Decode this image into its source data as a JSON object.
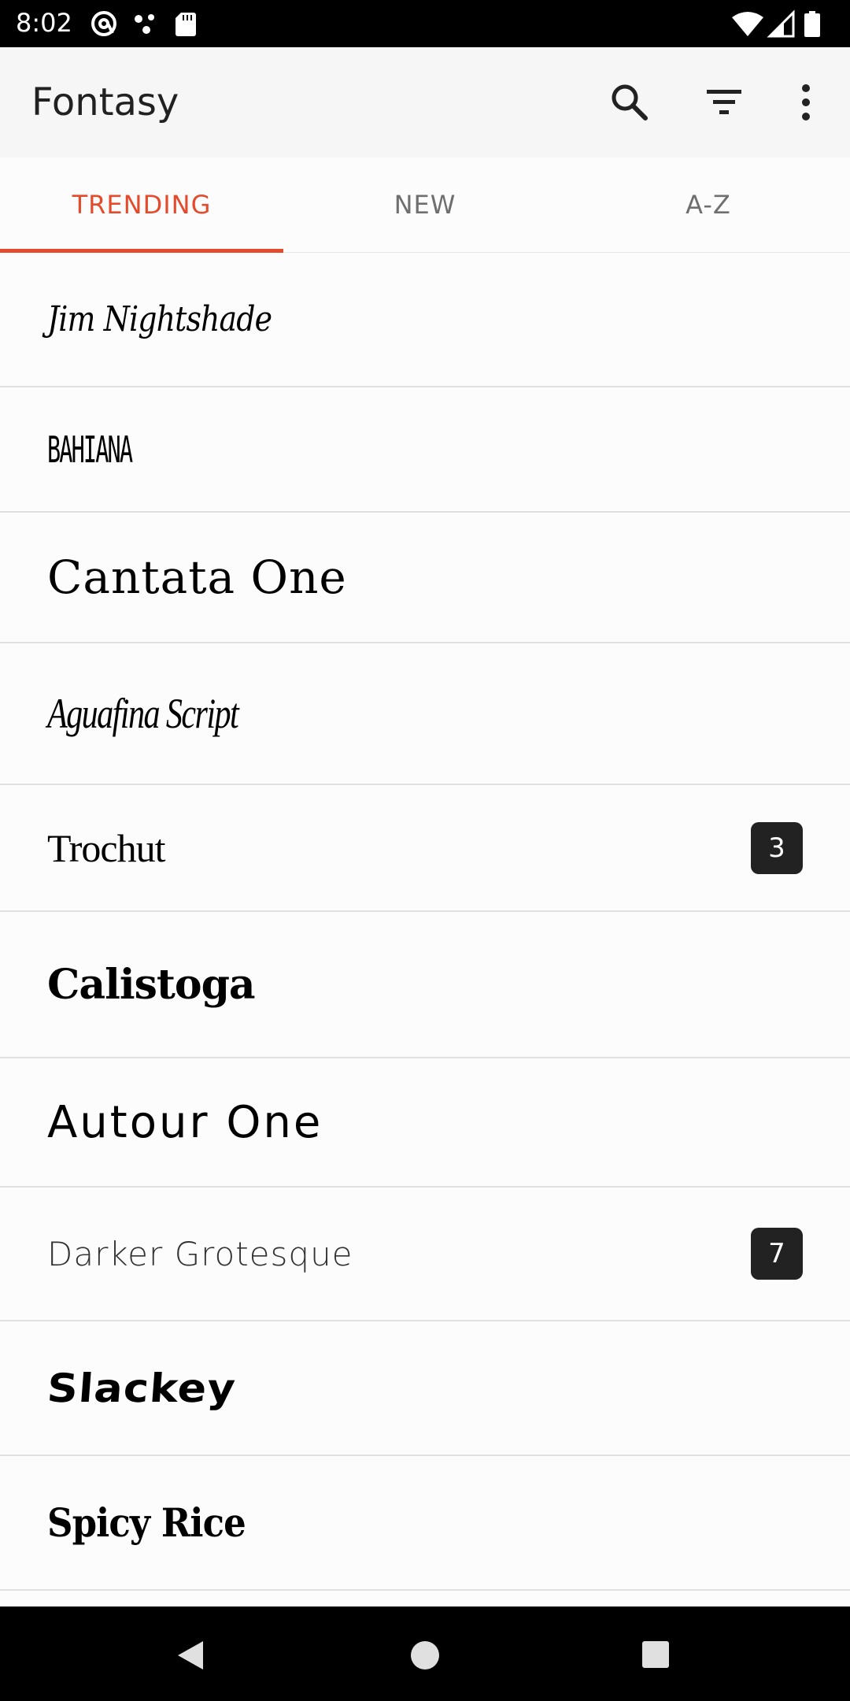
{
  "status_bar": {
    "time": "8:02",
    "left_icons": [
      "at-sign-icon",
      "nodes-icon",
      "sd-card-icon"
    ],
    "right_icons": [
      "wifi-icon",
      "signal-icon",
      "battery-icon"
    ]
  },
  "app_bar": {
    "title": "Fontasy",
    "actions": [
      "search-icon",
      "filter-icon",
      "more-vert-icon"
    ]
  },
  "tabs": [
    {
      "label": "TRENDING",
      "active": true
    },
    {
      "label": "NEW",
      "active": false
    },
    {
      "label": "A-Z",
      "active": false
    }
  ],
  "fonts": [
    {
      "name": "Jim Nightshade",
      "badge": null
    },
    {
      "name": "BAHIANA",
      "badge": null
    },
    {
      "name": "Cantata One",
      "badge": null
    },
    {
      "name": "Aguafina Script",
      "badge": null
    },
    {
      "name": "Trochut",
      "badge": "3"
    },
    {
      "name": "Calistoga",
      "badge": null
    },
    {
      "name": "Autour One",
      "badge": null
    },
    {
      "name": "Darker Grotesque",
      "badge": "7"
    },
    {
      "name": "Slackey",
      "badge": null
    },
    {
      "name": "Spicy Rice",
      "badge": null
    }
  ],
  "nav_bar": {
    "buttons": [
      "back-icon",
      "home-icon",
      "recents-icon"
    ]
  },
  "colors": {
    "accent": "#e44b2c",
    "badge_bg": "#222222",
    "app_bar_bg": "#f6f6f6"
  }
}
